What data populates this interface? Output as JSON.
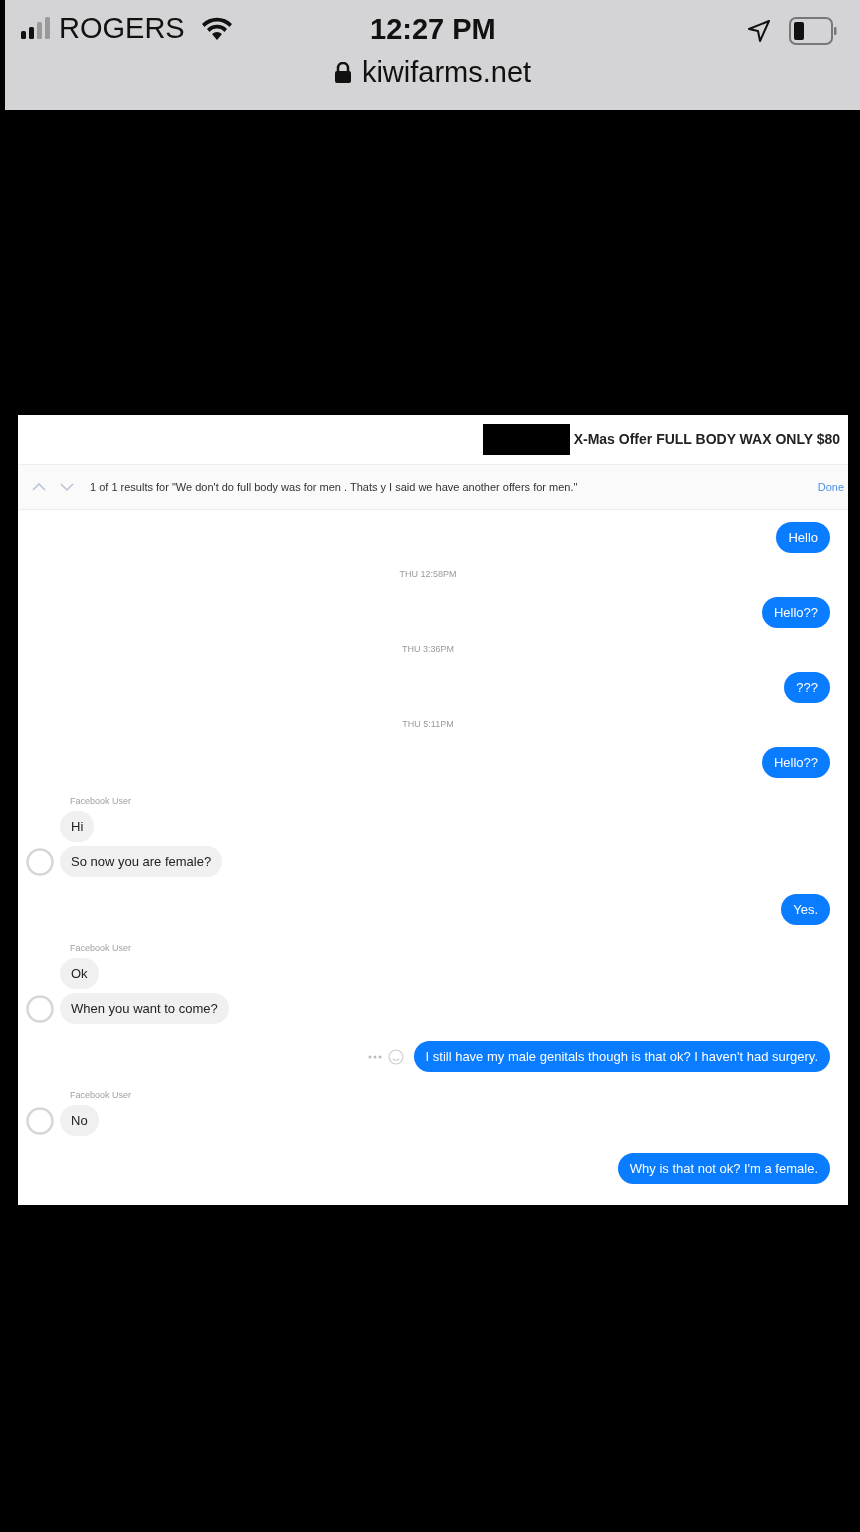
{
  "status_bar": {
    "carrier": "ROGERS",
    "time": "12:27 PM",
    "url": "kiwifarms.net"
  },
  "chat": {
    "title": "X-Mas Offer FULL BODY WAX ONLY $80",
    "search": {
      "results": "1 of 1 results for \"We don't do full body was for men . Thats y I said we have another offers for men.\"",
      "done": "Done"
    },
    "items": [
      {
        "kind": "outgoing",
        "text": "Hello",
        "actions": false
      },
      {
        "kind": "timestamp",
        "text": "THU 12:58PM"
      },
      {
        "kind": "outgoing",
        "text": "Hello??",
        "actions": false
      },
      {
        "kind": "timestamp",
        "text": "THU 3:36PM"
      },
      {
        "kind": "outgoing",
        "text": "???",
        "actions": false
      },
      {
        "kind": "timestamp",
        "text": "THU 5:11PM"
      },
      {
        "kind": "outgoing",
        "text": "Hello??",
        "actions": false
      },
      {
        "kind": "incoming",
        "sender": "Facebook User",
        "messages": [
          "Hi",
          "So now you are female?"
        ]
      },
      {
        "kind": "outgoing",
        "text": "Yes.",
        "actions": false
      },
      {
        "kind": "incoming",
        "sender": "Facebook User",
        "messages": [
          "Ok",
          "When you want to come?"
        ]
      },
      {
        "kind": "outgoing",
        "text": "I still have my male genitals though is that ok? I haven't had surgery.",
        "actions": true
      },
      {
        "kind": "incoming",
        "sender": "Facebook User",
        "messages": [
          "No"
        ]
      },
      {
        "kind": "outgoing",
        "text": "Why is that not ok? I'm a female.",
        "actions": false
      }
    ]
  }
}
